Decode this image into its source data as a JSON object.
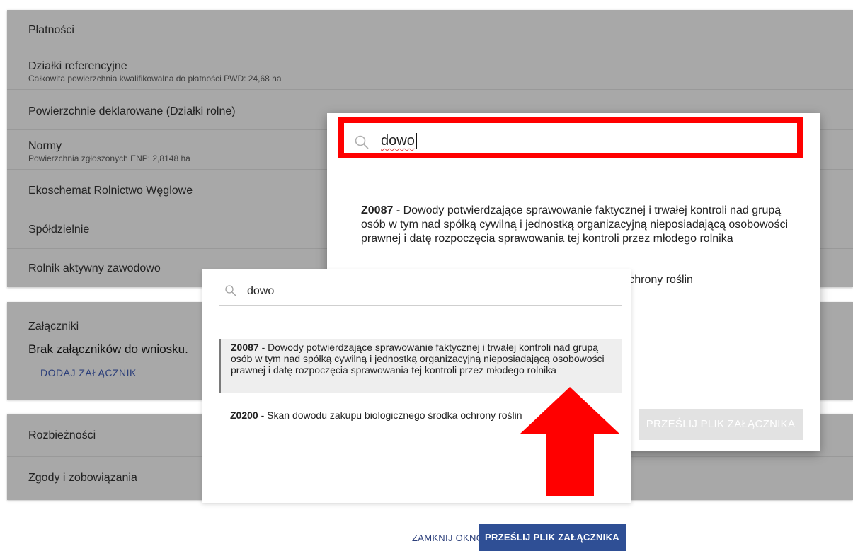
{
  "background": {
    "rows": [
      {
        "title": "Płatności",
        "sub": ""
      },
      {
        "title": "Działki referencyjne",
        "sub": "Całkowita powierzchnia kwalifikowalna do płatności PWD: 24,68 ha"
      },
      {
        "title": "Powierzchnie deklarowane (Działki rolne)",
        "sub": ""
      },
      {
        "title": "Normy",
        "sub": "Powierzchnia zgłoszonych ENP: 2,8148 ha"
      },
      {
        "title": "Ekoschemat Rolnictwo Węglowe",
        "sub": ""
      },
      {
        "title": "Spółdzielnie",
        "sub": ""
      },
      {
        "title": "Rolnik aktywny zawodowo",
        "sub": ""
      }
    ],
    "attachments": {
      "title": "Załączniki",
      "none_text": "Brak załączników do wniosku.",
      "add_label": "DODAJ ZAŁĄCZNIK"
    },
    "bottom_rows": [
      {
        "title": "Rozbieżności"
      },
      {
        "title": "Zgody i zobowiązania"
      }
    ]
  },
  "big_dialog": {
    "search_value": "dowo",
    "option1_code": "Z0087",
    "option1_text": " - Dowody potwierdzające sprawowanie faktycznej i trwałej kontroli nad grupą osób w tym nad spółką cywilną i jednostką organizacyjną nieposiadającą osobowości prawnej i datę rozpoczęcia sprawowania tej kontroli przez młodego rolnika",
    "option2_partial": "ka ochrony roślin",
    "submit_label": "PRZEŚLIJ PLIK ZAŁĄCZNIKA"
  },
  "small_dialog": {
    "search_value": "dowo",
    "option1_code": "Z0087",
    "option1_text": " - Dowody potwierdzające sprawowanie faktycznej i trwałej kontroli nad grupą osób w tym nad spółką cywilną i jednostką organizacyjną nieposiadającą osobowości prawnej i datę rozpoczęcia sprawowania tej kontroli przez młodego rolnika",
    "option2_code": "Z0200",
    "option2_text": " - Skan dowodu zakupu biologicznego środka ochrony roślin"
  },
  "footer": {
    "close_label": "ZAMKNIJ OKNO",
    "submit_label": "PRZEŚLIJ PLIK ZAŁĄCZNIKA"
  },
  "colors": {
    "highlight_border": "#ff0000",
    "arrow": "#ff0000",
    "primary_button": "#2f4f95",
    "link": "#2b3e7a"
  }
}
